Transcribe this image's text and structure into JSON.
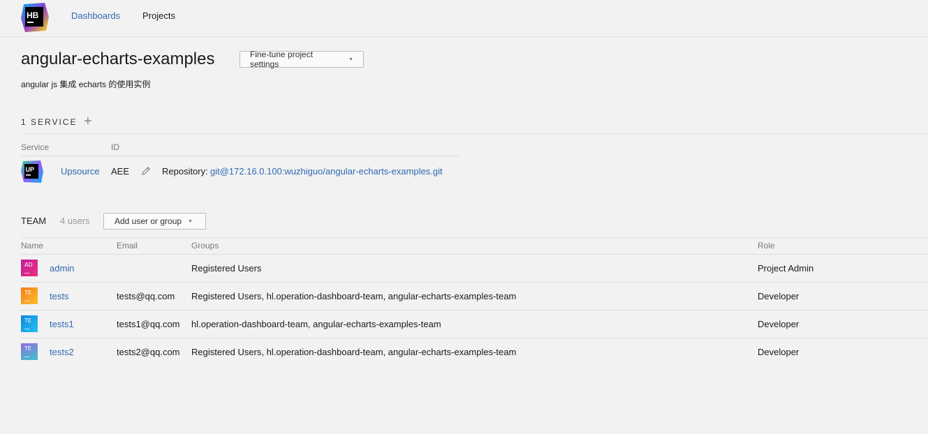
{
  "header": {
    "logo_text": "HB",
    "nav": [
      {
        "label": "Dashboards"
      },
      {
        "label": "Projects"
      }
    ]
  },
  "project": {
    "title": "angular-echarts-examples",
    "settings_button": "Fine-tune project settings",
    "description": "angular js 集成 echarts 的使用实例"
  },
  "services": {
    "heading": "1 SERVICE",
    "columns": {
      "service": "Service",
      "id": "ID"
    },
    "items": [
      {
        "logo_text": "UP",
        "name": "Upsource",
        "id": "AEE",
        "repo_label": "Repository:",
        "repo_url": "git@172.16.0.100:wuzhiguo/angular-echarts-examples.git"
      }
    ]
  },
  "team": {
    "heading": "TEAM",
    "count": "4 users",
    "add_button": "Add user or group",
    "columns": {
      "name": "Name",
      "email": "Email",
      "groups": "Groups",
      "role": "Role"
    },
    "members": [
      {
        "initials": "AD",
        "name": "admin",
        "email": "",
        "groups": "Registered Users",
        "role": "Project Admin",
        "color": "#c41c9c"
      },
      {
        "initials": "TE",
        "name": "tests",
        "email": "tests@qq.com",
        "groups": "Registered Users, hl.operation-dashboard-team, angular-echarts-examples-team",
        "role": "Developer",
        "color": "#f59b1a"
      },
      {
        "initials": "TE",
        "name": "tests1",
        "email": "tests1@qq.com",
        "groups": "hl.operation-dashboard-team, angular-echarts-examples-team",
        "role": "Developer",
        "color": "#1d9be6"
      },
      {
        "initials": "TE",
        "name": "tests2",
        "email": "tests2@qq.com",
        "groups": "Registered Users, hl.operation-dashboard-team, angular-echarts-examples-team",
        "role": "Developer",
        "color": "#7b78d6"
      }
    ]
  },
  "colors": {
    "link": "#2f69b3",
    "background": "#f2f2f2"
  }
}
